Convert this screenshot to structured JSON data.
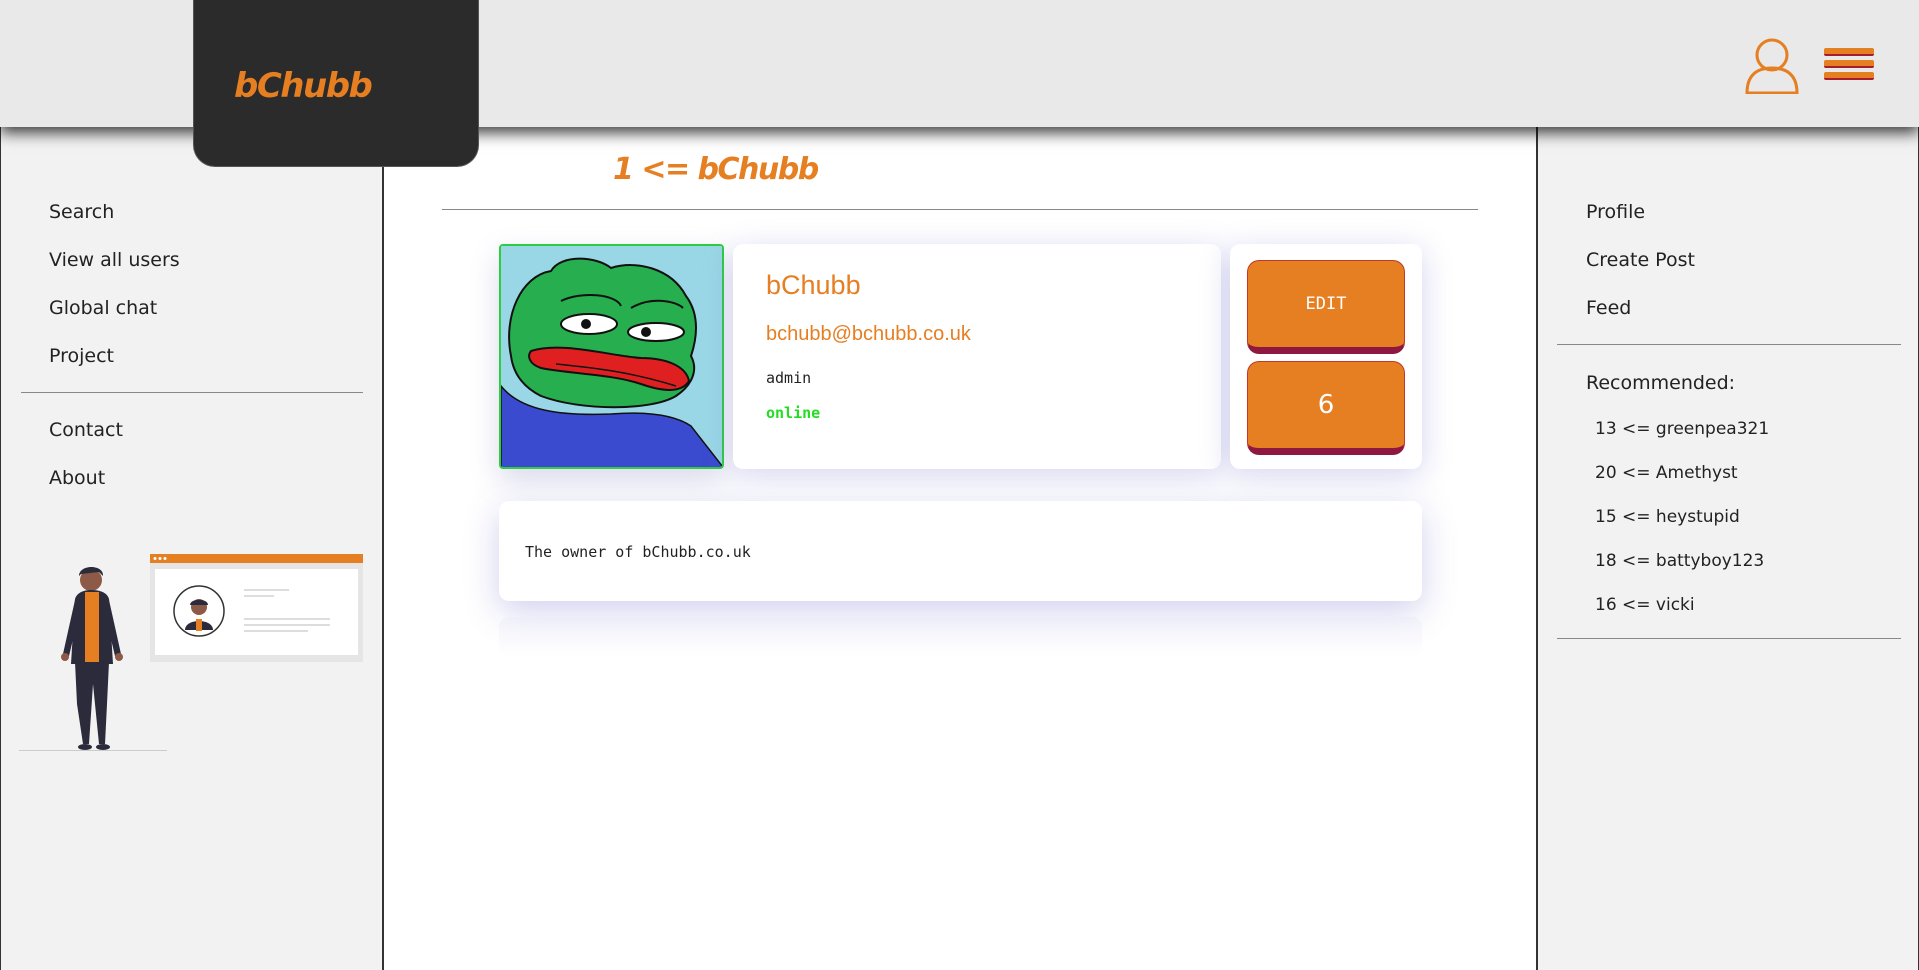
{
  "header": {
    "logo": "bChubb",
    "user_icon": "user-icon",
    "menu_icon": "hamburger-menu-icon"
  },
  "left_nav": {
    "items": [
      {
        "label": "Search"
      },
      {
        "label": "View all users"
      },
      {
        "label": "Global chat"
      },
      {
        "label": "Project"
      }
    ],
    "items2": [
      {
        "label": "Contact"
      },
      {
        "label": "About"
      }
    ]
  },
  "main": {
    "title": "1 <= bChubb",
    "profile": {
      "name": "bChubb",
      "email": "bchubb@bchubb.co.uk",
      "role": "admin",
      "status": "online"
    },
    "actions": {
      "edit_label": "EDIT",
      "count": "6"
    },
    "bio": "The owner of bChubb.co.uk"
  },
  "right_nav": {
    "items": [
      {
        "label": "Profile"
      },
      {
        "label": "Create Post"
      },
      {
        "label": "Feed"
      }
    ],
    "recommended_title": "Recommended:",
    "recommended": [
      {
        "label": "13 <= greenpea321"
      },
      {
        "label": "20 <= Amethyst"
      },
      {
        "label": "15 <= heystupid"
      },
      {
        "label": "18 <= battyboy123"
      },
      {
        "label": "16 <= vicki"
      }
    ]
  },
  "colors": {
    "accent": "#e67e22",
    "header_bg": "#e9e9e9",
    "logo_bg": "#2b2b2b",
    "online": "#22dd22"
  }
}
